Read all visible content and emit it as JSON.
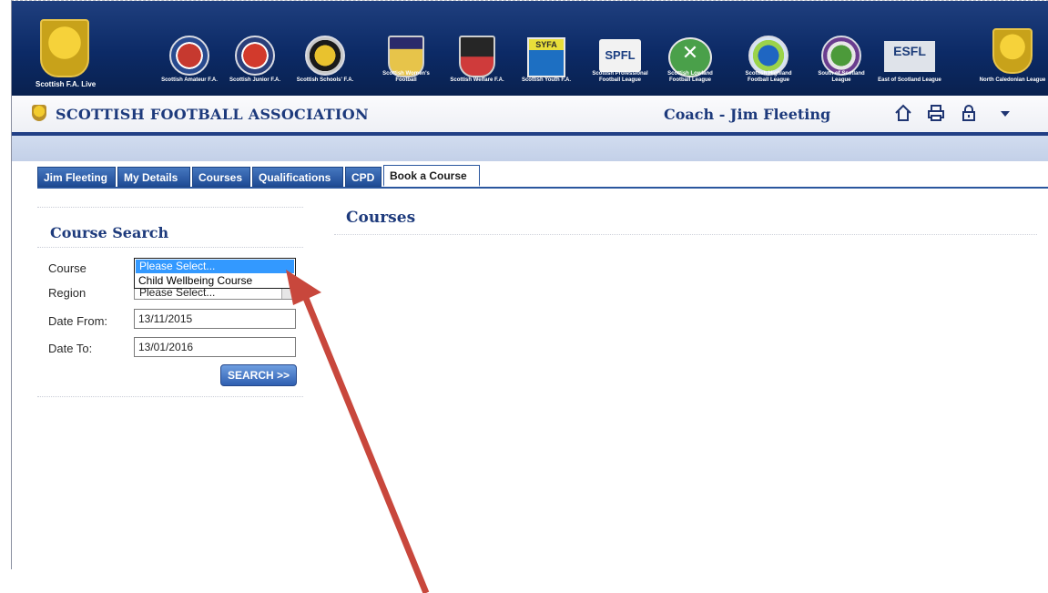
{
  "banner": {
    "orgs": [
      {
        "name": "Scottish F.A. Live"
      },
      {
        "name": "Scottish Amateur F.A."
      },
      {
        "name": "Scottish Junior F.A."
      },
      {
        "name": "Scottish Schools' F.A."
      },
      {
        "name": "Scottish Women's Football"
      },
      {
        "name": "Scottish Welfare F.A."
      },
      {
        "name": "Scottish Youth F.A."
      },
      {
        "name": "Scottish Professional Football League",
        "logo_text": "SPFL"
      },
      {
        "name": "Scottish Lowland Football League"
      },
      {
        "name": "Scottish Highland Football League"
      },
      {
        "name": "South of Scotland League"
      },
      {
        "name": "East of Scotland League",
        "logo_text": "ESFL"
      },
      {
        "name": "North Caledonian League"
      }
    ],
    "crest_label": "SCOTTISH F.A."
  },
  "header": {
    "site_title": "SCOTTISH FOOTBALL ASSOCIATION",
    "user_label": "Coach - Jim Fleeting",
    "icons": [
      "home-icon",
      "print-icon",
      "lock-icon",
      "dropdown-arrow-icon"
    ]
  },
  "tabs": [
    {
      "label": "Jim Fleeting",
      "active": false
    },
    {
      "label": "My Details",
      "active": false
    },
    {
      "label": "Courses",
      "active": false
    },
    {
      "label": "Qualifications",
      "active": false
    },
    {
      "label": "CPD",
      "active": false
    },
    {
      "label": "Book a Course",
      "active": true
    }
  ],
  "search": {
    "heading": "Course Search",
    "course_label": "Course",
    "course_options": [
      "Please Select...",
      "Child Wellbeing Course"
    ],
    "region_label": "Region",
    "region_value": "Please Select...",
    "date_from_label": "Date From:",
    "date_from_value": "13/11/2015",
    "date_to_label": "Date To:",
    "date_to_value": "13/01/2016",
    "button_label": "SEARCH >>"
  },
  "main": {
    "heading": "Courses"
  },
  "colors": {
    "navy": "#1d3a7c",
    "tab_blue": "#2a569e",
    "annotation_arrow": "#c8473c",
    "selection": "#3399ff"
  }
}
